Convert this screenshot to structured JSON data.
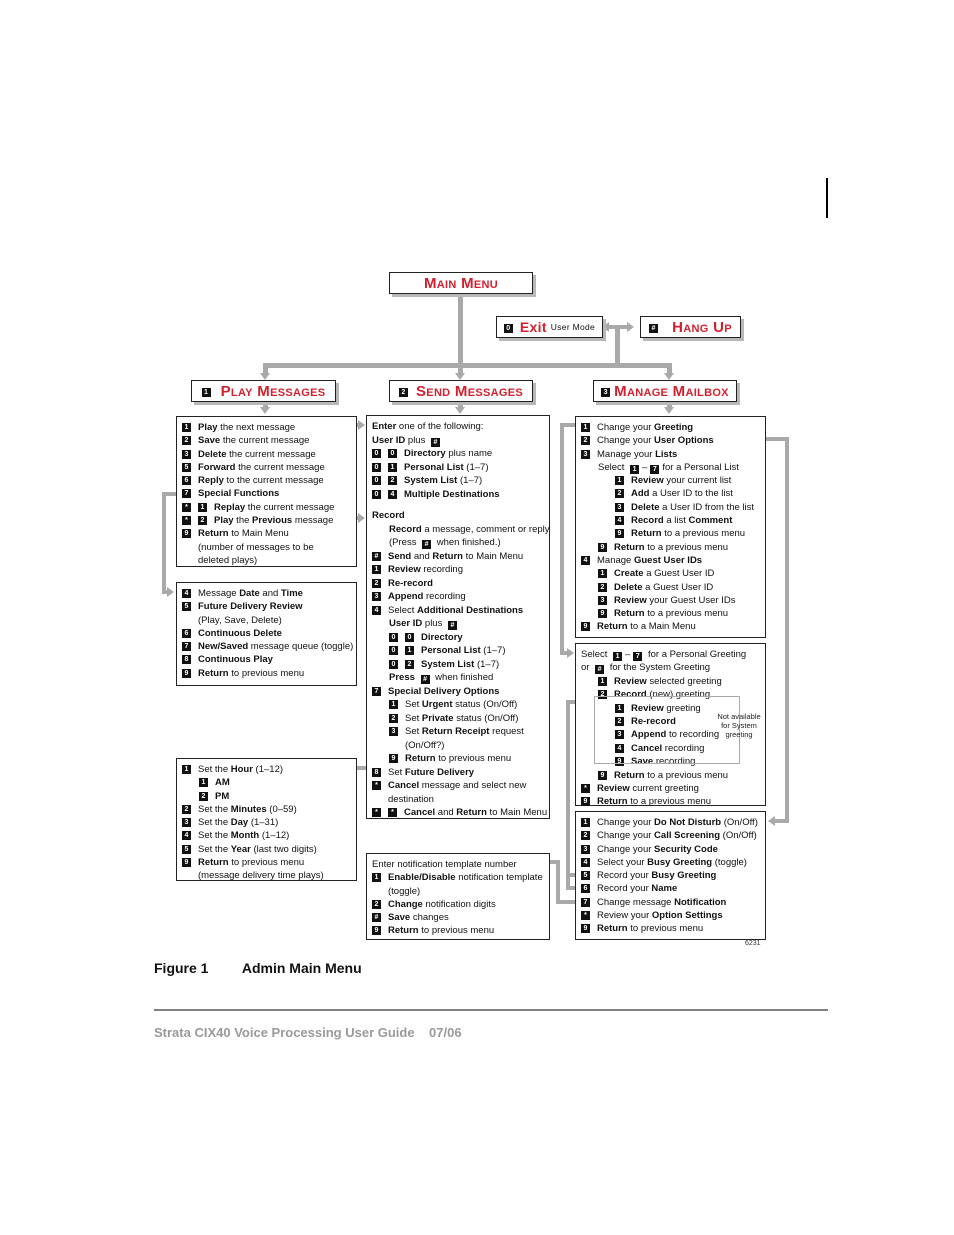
{
  "titles": {
    "main_menu": "Main Menu",
    "exit_key": "0",
    "exit_label": "Exit",
    "exit_sub": "User Mode",
    "hangup_key": "#",
    "hangup_label": "Hang Up",
    "play_key": "1",
    "play_label": "Play Messages",
    "send_key": "2",
    "send_label": "Send Messages",
    "manage_key": "3",
    "manage_label": "Manage Mailbox"
  },
  "play_box": [
    {
      "keys": [
        "1"
      ],
      "bold": "Play",
      "rest": " the next message"
    },
    {
      "keys": [
        "2"
      ],
      "bold": "Save",
      "rest": " the current message"
    },
    {
      "keys": [
        "3"
      ],
      "bold": "Delete",
      "rest": " the current message"
    },
    {
      "keys": [
        "5"
      ],
      "bold": "Forward",
      "rest": " the current message"
    },
    {
      "keys": [
        "6"
      ],
      "bold": "Reply",
      "rest": " to the current message"
    },
    {
      "keys": [
        "7"
      ],
      "bold": "Special Functions",
      "rest": ""
    },
    {
      "keys": [
        "*",
        "1"
      ],
      "bold": "Replay",
      "rest": " the current message"
    },
    {
      "keys": [
        "*",
        "2"
      ],
      "html": "<b>Play</b> the <b>Previous</b> message"
    },
    {
      "keys": [
        "9"
      ],
      "html": "<b>Return</b> to  Main Menu<br>(number of messages to be<br>deleted plays)"
    }
  ],
  "date_box": [
    {
      "keys": [
        "4"
      ],
      "html": "Message <b>Date</b> and <b>Time</b>"
    },
    {
      "keys": [
        "5"
      ],
      "html": "<b>Future Delivery Review</b><br>(Play, Save, Delete)"
    },
    {
      "keys": [
        "6"
      ],
      "html": "<b>Continuous Delete</b>"
    },
    {
      "keys": [
        "7"
      ],
      "html": "<b>New/Saved</b> message queue (toggle)"
    },
    {
      "keys": [
        "8"
      ],
      "html": "<b>Continuous Play</b>"
    },
    {
      "keys": [
        "9"
      ],
      "html": "<b>Return</b> to previous menu"
    }
  ],
  "time_box": [
    {
      "keys": [
        "1"
      ],
      "html": "Set the <b>Hour</b> (1–12)"
    },
    {
      "keys": [
        "1"
      ],
      "html": "<b>AM</b>",
      "indent": 1
    },
    {
      "keys": [
        "2"
      ],
      "html": "<b>PM</b>",
      "indent": 1
    },
    {
      "keys": [
        "2"
      ],
      "html": "Set the <b>Minutes</b> (0–59)"
    },
    {
      "keys": [
        "3"
      ],
      "html": "Set the <b>Day</b> (1–31)"
    },
    {
      "keys": [
        "4"
      ],
      "html": "Set the <b>Month</b> (1–12)"
    },
    {
      "keys": [
        "5"
      ],
      "html": "Set the <b>Year</b> (last two digits)"
    },
    {
      "keys": [
        "9"
      ],
      "html": "<b>Return</b> to previous menu<br>(message delivery time plays)"
    }
  ],
  "send_box": [
    {
      "keys": [],
      "html": "<b>Enter</b> one of the following:"
    },
    {
      "keys": [],
      "html": "<b>User ID</b> plus <span class='key inl'>#</span>"
    },
    {
      "keys": [
        "0",
        "0"
      ],
      "html": "<b>Directory</b> plus name"
    },
    {
      "keys": [
        "0",
        "1"
      ],
      "html": "<b>Personal List</b> (1–7)"
    },
    {
      "keys": [
        "0",
        "2"
      ],
      "html": "<b>System List</b> (1–7)"
    },
    {
      "keys": [
        "0",
        "4"
      ],
      "html": "<b>Multiple Destinations</b>"
    },
    {
      "keys": [],
      "html": "&nbsp;",
      "gap": 1
    },
    {
      "keys": [],
      "html": "<b>Record</b>"
    },
    {
      "keys": [],
      "html": "<b>Record</b> a message, comment or reply<br>(Press <span class='key inl'>#</span> when finished.)",
      "indent": 1
    },
    {
      "keys": [
        "#"
      ],
      "html": "<b>Send</b> and <b>Return</b> to Main Menu"
    },
    {
      "keys": [
        "1"
      ],
      "html": "<b>Review</b> recording"
    },
    {
      "keys": [
        "2"
      ],
      "html": "<b>Re-record</b>"
    },
    {
      "keys": [
        "3"
      ],
      "html": "<b>Append</b> recording"
    },
    {
      "keys": [
        "4"
      ],
      "html": "Select <b>Additional Destinations</b>"
    },
    {
      "keys": [],
      "html": "<b>User ID</b> plus <span class='key inl'>#</span>",
      "indent": 1
    },
    {
      "keys": [
        "0",
        "0"
      ],
      "html": "<b>Directory</b>",
      "indent": 1
    },
    {
      "keys": [
        "0",
        "1"
      ],
      "html": "<b>Personal List</b> (1–7)",
      "indent": 1
    },
    {
      "keys": [
        "0",
        "2"
      ],
      "html": "<b>System List</b> (1–7)",
      "indent": 1
    },
    {
      "keys": [],
      "html": "<b>Press</b> <span class='key inl'>#</span> when finished",
      "indent": 1
    },
    {
      "keys": [
        "7"
      ],
      "html": "<b>Special Delivery Options</b>"
    },
    {
      "keys": [
        "1"
      ],
      "html": "Set <b>Urgent</b> status (On/Off)",
      "indent": 1
    },
    {
      "keys": [
        "2"
      ],
      "html": "Set <b>Private</b> status (On/Off)",
      "indent": 1
    },
    {
      "keys": [
        "3"
      ],
      "html": "Set <b>Return Receipt</b> request<br>(On/Off?)",
      "indent": 1
    },
    {
      "keys": [
        "9"
      ],
      "html": "<b>Return</b> to previous menu",
      "indent": 1
    },
    {
      "keys": [
        "8"
      ],
      "html": "Set <b>Future Delivery</b>"
    },
    {
      "keys": [
        "*"
      ],
      "html": "<b>Cancel</b> message and select new<br>destination"
    },
    {
      "keys": [
        "*",
        "*"
      ],
      "html": "<b>Cancel</b> and <b>Return</b> to Main Menu"
    }
  ],
  "notify_box": [
    {
      "keys": [],
      "html": "Enter notification template number"
    },
    {
      "keys": [
        "1"
      ],
      "html": "<b>Enable/Disable</b> notification template<br>(toggle)"
    },
    {
      "keys": [
        "2"
      ],
      "html": "<b>Change</b> notification digits"
    },
    {
      "keys": [
        "#"
      ],
      "html": "<b>Save</b> changes"
    },
    {
      "keys": [
        "9"
      ],
      "html": "<b>Return</b> to previous menu"
    }
  ],
  "manage_box": [
    {
      "keys": [
        "1"
      ],
      "html": "Change your <b>Greeting</b>"
    },
    {
      "keys": [
        "2"
      ],
      "html": "Change your <b>User Options</b>"
    },
    {
      "keys": [
        "3"
      ],
      "html": "Manage your <b>Lists</b>"
    },
    {
      "keys": [],
      "html": "Select <span class='key inl'>1</span>–<span class='key inl'>7</span>for a Personal List",
      "indent": 1
    },
    {
      "keys": [
        "1"
      ],
      "html": "<b>Review</b> your current list",
      "indent": 2
    },
    {
      "keys": [
        "2"
      ],
      "html": "<b>Add</b> a User ID to the list",
      "indent": 2
    },
    {
      "keys": [
        "3"
      ],
      "html": "<b>Delete</b> a User ID from the list",
      "indent": 2
    },
    {
      "keys": [
        "4"
      ],
      "html": "<b>Record</b> a list <b>Comment</b>",
      "indent": 2
    },
    {
      "keys": [
        "9"
      ],
      "html": "<b>Return</b> to a previous menu",
      "indent": 2
    },
    {
      "keys": [
        "9"
      ],
      "html": "<b>Return</b> to a previous menu",
      "indent": 1
    },
    {
      "keys": [
        "4"
      ],
      "html": "Manage <b>Guest User IDs</b>"
    },
    {
      "keys": [
        "1"
      ],
      "html": "<b>Create</b> a Guest User ID",
      "indent": 1
    },
    {
      "keys": [
        "2"
      ],
      "html": "<b>Delete</b> a Guest User ID",
      "indent": 1
    },
    {
      "keys": [
        "3"
      ],
      "html": "<b>Review</b> your Guest User IDs",
      "indent": 1
    },
    {
      "keys": [
        "9"
      ],
      "html": "<b>Return</b> to a previous menu",
      "indent": 1
    },
    {
      "keys": [
        "9"
      ],
      "html": "<b>Return</b> to a Main Menu"
    }
  ],
  "greeting_box": [
    {
      "keys": [],
      "html": "Select <span class='key inl'>1</span>–<span class='key inl'>7</span> for a Personal Greeting<br>or <span class='key inl'>#</span> for the System Greeting"
    },
    {
      "keys": [
        "1"
      ],
      "html": "<b>Review</b> selected greeting",
      "indent": 1
    },
    {
      "keys": [
        "2"
      ],
      "html": "<b>Record</b> (new) greeting",
      "indent": 1
    },
    {
      "keys": [
        "1"
      ],
      "html": "<b>Review</b> greeting",
      "indent": 2
    },
    {
      "keys": [
        "2"
      ],
      "html": "<b>Re-record</b>",
      "indent": 2
    },
    {
      "keys": [
        "3"
      ],
      "html": "<b>Append</b> to recording",
      "indent": 2
    },
    {
      "keys": [
        "4"
      ],
      "html": "<b>Cancel</b> recording",
      "indent": 2
    },
    {
      "keys": [
        "9"
      ],
      "html": "<b>Save</b> recording",
      "indent": 2
    },
    {
      "keys": [
        "9"
      ],
      "html": "<b>Return</b> to a previous menu",
      "indent": 1
    },
    {
      "keys": [
        "*"
      ],
      "html": "<b>Review</b> current greeting"
    },
    {
      "keys": [
        "9"
      ],
      "html": "<b>Return</b> to a previous menu"
    }
  ],
  "greeting_note": "Not available for System greeting",
  "options_box": [
    {
      "keys": [
        "1"
      ],
      "html": "Change your <b>Do Not Disturb</b> (On/Off)"
    },
    {
      "keys": [
        "2"
      ],
      "html": "Change your <b>Call Screening</b> (On/Off)"
    },
    {
      "keys": [
        "3"
      ],
      "html": "Change your <b>Security Code</b>"
    },
    {
      "keys": [
        "4"
      ],
      "html": "Select your <b>Busy Greeting</b> (toggle)"
    },
    {
      "keys": [
        "5"
      ],
      "html": "Record your <b>Busy Greeting</b>"
    },
    {
      "keys": [
        "6"
      ],
      "html": "Record your <b>Name</b>"
    },
    {
      "keys": [
        "7"
      ],
      "html": "Change message <b>Notification</b>"
    },
    {
      "keys": [
        "*"
      ],
      "html": "Review your <b>Option Settings</b>"
    },
    {
      "keys": [
        "9"
      ],
      "html": "<b>Return</b> to previous menu"
    }
  ],
  "figure_number": "6231",
  "caption": {
    "label": "Figure 1",
    "title": "Admin Main Menu"
  },
  "footer": "Strata CIX40 Voice Processing User Guide    07/06"
}
